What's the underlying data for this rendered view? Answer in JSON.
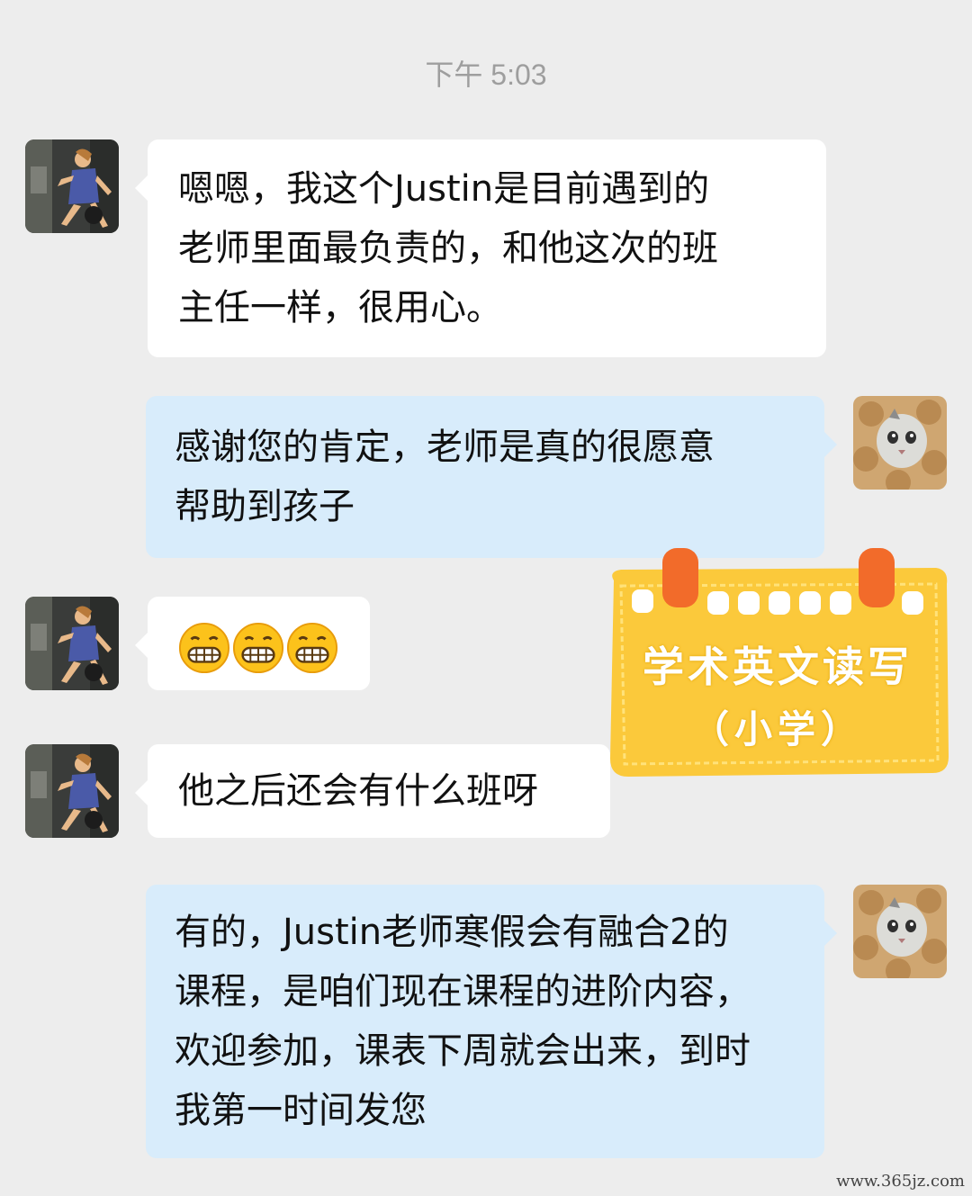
{
  "timestamp": "下午 5:03",
  "messages": [
    {
      "sender": "other",
      "text": "嗯嗯，我这个Justin是目前遇到的老师里面最负责的，和他这次的班主任一样，很用心。",
      "lines": [
        "嗯嗯，我这个Justin是目前遇到的",
        "老师里面最负责的，和他这次的班",
        "主任一样，很用心。"
      ]
    },
    {
      "sender": "self",
      "text": "感谢您的肯定，老师是真的很愿意帮助到孩子",
      "lines": [
        "感谢您的肯定，老师是真的很愿意",
        "帮助到孩子"
      ]
    },
    {
      "sender": "other",
      "emoji": [
        "grimacing-face",
        "grimacing-face",
        "grimacing-face"
      ]
    },
    {
      "sender": "other",
      "text": "他之后还会有什么班呀",
      "lines": [
        "他之后还会有什么班呀"
      ]
    },
    {
      "sender": "self",
      "text": "有的，Justin老师寒假会有融合2的课程，是咱们现在课程的进阶内容，欢迎参加，课表下周就会出来，到时我第一时间发您",
      "lines": [
        "有的，Justin老师寒假会有融合2的",
        "课程，是咱们现在课程的进阶内容，",
        "欢迎参加，课表下周就会出来，到时",
        "我第一时间发您"
      ]
    }
  ],
  "sticker": {
    "title": "学术英文读写",
    "subtitle": "（小学）",
    "color": "#fbc93b",
    "accent": "#f26b2a"
  },
  "watermark": "www.365jz.com",
  "colors": {
    "background": "#ededed",
    "incoming_bubble": "#ffffff",
    "outgoing_bubble": "#d8ecfb",
    "timestamp": "#9e9e9e"
  }
}
